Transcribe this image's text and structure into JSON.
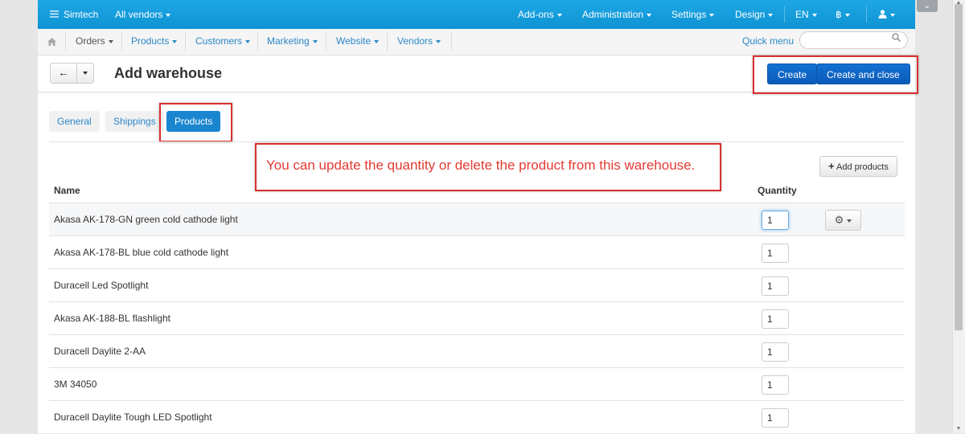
{
  "topbar": {
    "brand": "Simtech",
    "vendor_select": "All vendors",
    "menus": [
      "Add-ons",
      "Administration",
      "Settings",
      "Design",
      "EN",
      "฿",
      ""
    ]
  },
  "navbar": {
    "items": [
      "Orders",
      "Products",
      "Customers",
      "Marketing",
      "Website",
      "Vendors"
    ],
    "quick_menu": "Quick menu",
    "search_placeholder": ""
  },
  "titlebar": {
    "title": "Add warehouse",
    "create_label": "Create",
    "create_close_label": "Create and close"
  },
  "tabs": [
    {
      "label": "General",
      "active": false
    },
    {
      "label": "Shippings",
      "active": false
    },
    {
      "label": "Products",
      "active": true
    }
  ],
  "annotation": "You can update the quantity or delete the product from this warehouse.",
  "add_products_label": "Add products",
  "table": {
    "headers": {
      "name": "Name",
      "quantity": "Quantity"
    },
    "rows": [
      {
        "name": "Akasa AK-178-GN green cold cathode light",
        "qty": "1"
      },
      {
        "name": "Akasa AK-178-BL blue cold cathode light",
        "qty": "1"
      },
      {
        "name": "Duracell Led Spotlight",
        "qty": "1"
      },
      {
        "name": "Akasa AK-188-BL flashlight",
        "qty": "1"
      },
      {
        "name": "Duracell Daylite 2-AA",
        "qty": "1"
      },
      {
        "name": "3M 34050",
        "qty": "1"
      },
      {
        "name": "Duracell Daylite Tough LED Spotlight",
        "qty": "1"
      }
    ]
  },
  "colors": {
    "topbar": "#139fe0",
    "primary_button": "#0b63c4",
    "annotation": "#d9312f"
  }
}
